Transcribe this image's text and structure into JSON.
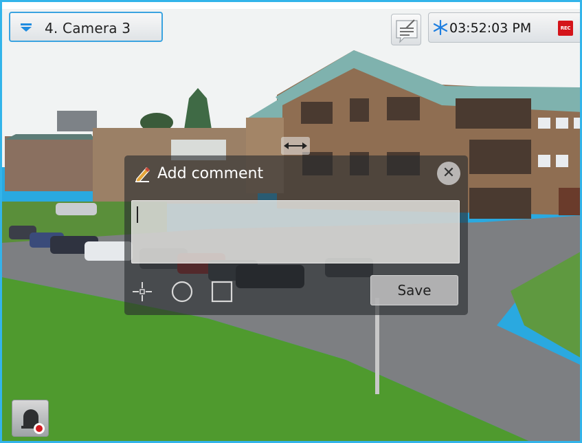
{
  "camera": {
    "selector_label": "4. Camera 3",
    "selector_icon": "chevron-down-icon"
  },
  "header": {
    "time": "03:52:03 PM",
    "freeze_icon": "snowflake-icon",
    "rec_badge": "REC",
    "comment_icon": "comment-note-icon"
  },
  "comment_dialog": {
    "title": "Add comment",
    "input_value": "",
    "save_label": "Save",
    "tools": [
      "point-icon",
      "circle-icon",
      "rectangle-icon"
    ]
  },
  "alarm": {
    "icon": "alarm-bell-icon"
  },
  "colors": {
    "accent": "#33b4ea",
    "rec": "#d4141a",
    "snowflake": "#1f7fe0"
  }
}
